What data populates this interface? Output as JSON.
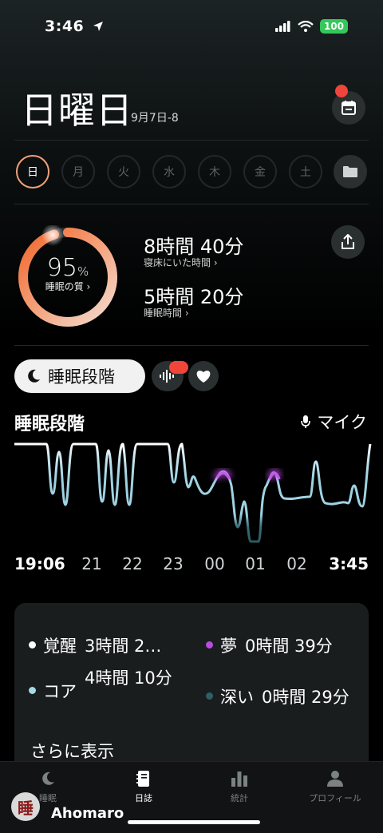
{
  "status": {
    "time": "3:46",
    "battery": "100"
  },
  "header": {
    "day": "日曜日",
    "date_range": "9月7日-8"
  },
  "weekdays": [
    {
      "label": "日",
      "active": true
    },
    {
      "label": "月",
      "active": false
    },
    {
      "label": "火",
      "active": false
    },
    {
      "label": "水",
      "active": false
    },
    {
      "label": "木",
      "active": false
    },
    {
      "label": "金",
      "active": false
    },
    {
      "label": "土",
      "active": false
    }
  ],
  "summary": {
    "quality_value": "95",
    "quality_unit": "%",
    "quality_label": "睡眠の質 ›",
    "quality_fraction": 0.95,
    "time_in_bed": "8時間 40分",
    "time_in_bed_label": "寝床にいた時間 ›",
    "sleep_time": "5時間 20分",
    "sleep_time_label": "睡眠時間 ›"
  },
  "tabs": {
    "stage_label": "睡眠段階"
  },
  "section": {
    "title": "睡眠段階",
    "mic_label": "マイク"
  },
  "time_axis": [
    "19:06",
    "21",
    "22",
    "23",
    "00",
    "01",
    "02",
    "3:45"
  ],
  "legend": {
    "awake_name": "覚醒",
    "awake_value": "3時間 2…",
    "rem_name": "夢",
    "rem_value": "0時間 39分",
    "core_name": "コア",
    "core_value": "4時間 10分",
    "deep_name": "深い",
    "deep_value": "0時間 29分",
    "more": "さらに表示"
  },
  "nav": {
    "sleep": "睡眠",
    "journal": "日誌",
    "stats": "統計",
    "profile": "プロフィール"
  },
  "watermark": {
    "text": "Ahomaro",
    "logo_char": "睡"
  },
  "colors": {
    "awake": "#ffffff",
    "rem": "#b84be0",
    "core": "#a8d8e8",
    "deep": "#2f5f66",
    "accent": "#f07a3a"
  }
}
